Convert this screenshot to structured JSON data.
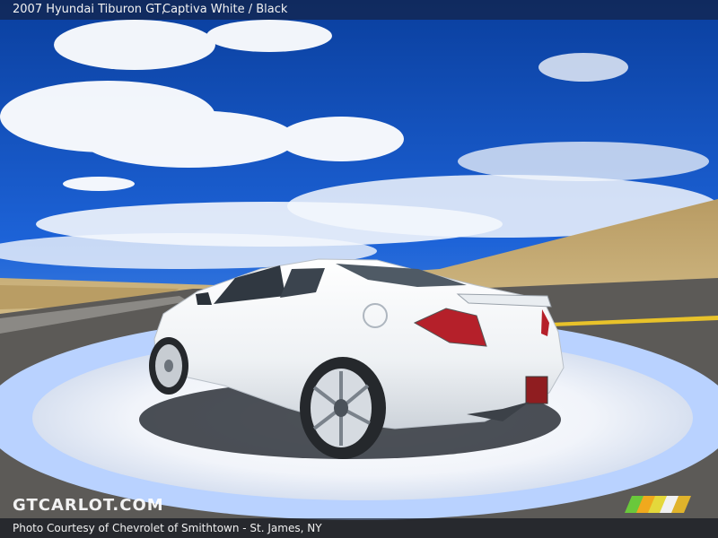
{
  "header": {
    "title": "2007 Hyundai Tiburon GT,",
    "subtitle": "Captiva White / Black"
  },
  "footer": {
    "credit": "Photo Courtesy of Chevrolet of Smithtown - St. James, NY"
  },
  "watermark": {
    "text": "GTCARLOT.COM"
  },
  "colors": {
    "sky": "#0a44b5",
    "car": "#f3f5f7",
    "platform": "#b8d2ff",
    "hill": "#c7b07e"
  },
  "icons": {
    "logo": "stripes-logo"
  }
}
